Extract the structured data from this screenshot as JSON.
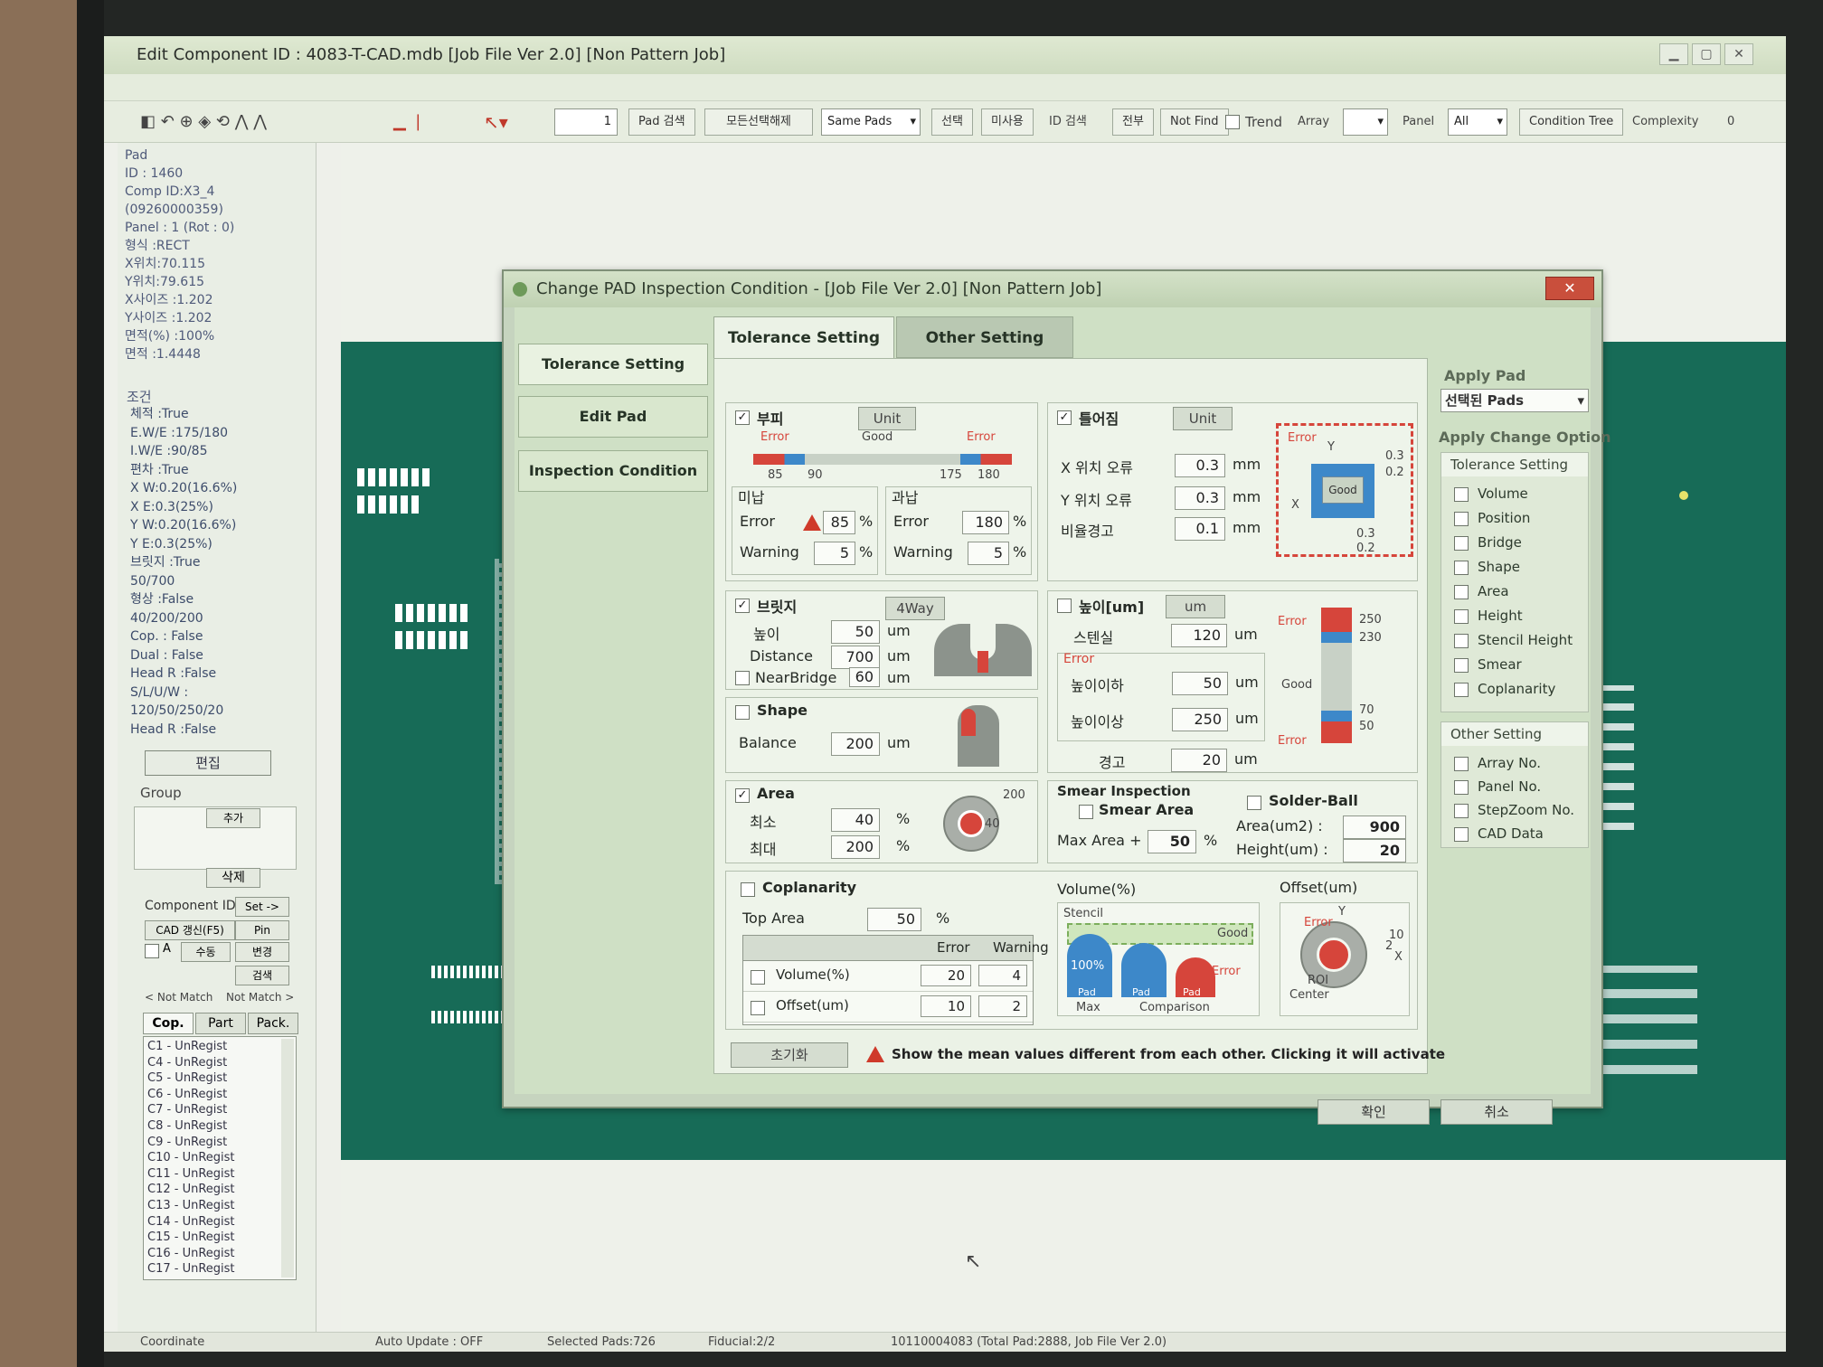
{
  "window": {
    "title": "Edit Component ID : 4083-T-CAD.mdb [Job File Ver 2.0] [Non Pattern Job]"
  },
  "toolbar": {
    "pad_no": "1",
    "pad_search": "Pad 검색",
    "select_all_cancel": "모든선택해제",
    "same_pads": "Same Pads",
    "select": "선택",
    "unselect": "미사용",
    "id_search": "ID 검색",
    "all": "전부",
    "not_find": "Not Find",
    "trend": "Trend",
    "array": "Array",
    "panel": "Panel",
    "panel_value": "All",
    "condition_tree": "Condition Tree",
    "complexity": "Complexity",
    "complexity_value": "0"
  },
  "info": {
    "lines": [
      "Pad",
      "ID  : 1460",
      "Comp ID:X3_4",
      "(09260000359)",
      "Panel : 1 (Rot : 0)",
      "형식 :RECT",
      "X위치:70.115",
      "Y위치:79.615",
      "X사이즈 :1.202",
      "Y사이즈 :1.202",
      "면적(%) :100%",
      "면적  :1.4448"
    ],
    "cond_title": "조건",
    "cond_lines": [
      "체적 :True",
      "E.W/E :175/180",
      "I.W/E :90/85",
      "편차 :True",
      "X W:0.20(16.6%)",
      "X E:0.3(25%)",
      "Y W:0.20(16.6%)",
      "Y E:0.3(25%)",
      "브릿지 :True",
      "50/700",
      "형상 :False",
      "40/200/200",
      "Cop.  : False",
      "Dual  : False",
      "Head R :False",
      "S/L/U/W :",
      "120/50/250/20",
      "Head R :False"
    ],
    "edit": "편집",
    "group": "Group",
    "add": "추가",
    "delete": "삭제",
    "component_id": "Component ID",
    "set": "Set ->",
    "cad_update": "CAD 갱신(F5)",
    "pin": "Pin",
    "a_label": "A",
    "register": "수동",
    "change": "변경",
    "search": "검색",
    "not_match_left": "< Not Match",
    "not_match_right": "Not Match >",
    "tabs": [
      "Cop.",
      "Part",
      "Pack."
    ],
    "list": [
      "C1 - UnRegist",
      "C4 - UnRegist",
      "C5 - UnRegist",
      "C6 - UnRegist",
      "C7 - UnRegist",
      "C8 - UnRegist",
      "C9 - UnRegist",
      "C10 - UnRegist",
      "C11 - UnRegist",
      "C12 - UnRegist",
      "C13 - UnRegist",
      "C14 - UnRegist",
      "C15 - UnRegist",
      "C16 - UnRegist",
      "C17 - UnRegist"
    ]
  },
  "status": {
    "coordinate": "Coordinate",
    "auto_update": "Auto Update : OFF",
    "selected_pads": "Selected Pads:726",
    "fiducial": "Fiducial:2/2",
    "job": "10110004083 (Total Pad:2888, Job File Ver 2.0)"
  },
  "dialog": {
    "title": "Change PAD Inspection Condition - [Job File Ver 2.0] [Non Pattern Job]",
    "close": "✕",
    "nav": [
      "Tolerance Setting",
      "Edit Pad",
      "Inspection Condition"
    ],
    "tabs": [
      "Tolerance Setting",
      "Other Setting"
    ],
    "volume": {
      "title": "부피",
      "unit_btn": "Unit",
      "error_l": "Error",
      "good": "Good",
      "error_r": "Error",
      "ticks": [
        "85",
        "90",
        "175",
        "180"
      ],
      "under": "미납",
      "over": "과납",
      "error": "Error",
      "warning": "Warning",
      "under_error": "85",
      "under_warning": "5",
      "over_error": "180",
      "over_warning": "5",
      "pct": "%"
    },
    "offset": {
      "title": "틀어짐",
      "unit_btn": "Unit",
      "x_err": "X 위치 오류",
      "y_err": "Y 위치 오류",
      "ratio": "비율경고",
      "x_val": "0.3",
      "y_val": "0.3",
      "ratio_val": "0.1",
      "mm": "mm",
      "diag_error": "Error",
      "diag_good": "Good",
      "diag_y": "Y",
      "diag_x": "X",
      "diag_v1": "0.3",
      "diag_v2": "0.2",
      "diag_v3": "0.3",
      "diag_v4": "0.2"
    },
    "bridge": {
      "title": "브릿지",
      "way_btn": "4Way",
      "height": "높이",
      "height_val": "50",
      "distance": "Distance",
      "distance_val": "700",
      "nearbridge": "NearBridge",
      "nearbridge_val": "60",
      "um": "um"
    },
    "height": {
      "title": "높이[um]",
      "um_btn": "um",
      "stencil": "스텐실",
      "stencil_val": "120",
      "error_grp": "Error",
      "low": "높이이하",
      "low_val": "50",
      "high": "높이이상",
      "high_val": "250",
      "warn": "경고",
      "warn_val": "20",
      "um": "um",
      "diag_error_top": "Error",
      "diag_good": "Good",
      "diag_error_bottom": "Error",
      "diag_ticks": [
        "250",
        "230",
        "70",
        "50"
      ]
    },
    "shape": {
      "title": "Shape",
      "balance": "Balance",
      "balance_val": "200",
      "um": "um"
    },
    "area": {
      "title": "Area",
      "min": "최소",
      "max": "최대",
      "min_val": "40",
      "max_val": "200",
      "pct": "%",
      "diag_200": "200",
      "diag_40": "40"
    },
    "smear": {
      "title": "Smear Inspection",
      "area_title": "Smear Area",
      "max_area": "Max Area +",
      "max_area_val": "50",
      "pct": "%",
      "solder_ball": "Solder-Ball",
      "area_um2": "Area(um2) :",
      "area_um2_val": "900",
      "height_um": "Height(um) :",
      "height_um_val": "20"
    },
    "coplanarity": {
      "title": "Coplanarity",
      "top_area": "Top Area",
      "top_area_val": "50",
      "pct": "%",
      "col_error": "Error",
      "col_warning": "Warning",
      "rows": [
        {
          "name": "Volume(%)",
          "error": "20",
          "warning": "4"
        },
        {
          "name": "Offset(um)",
          "error": "10",
          "warning": "2"
        }
      ],
      "vol_title": "Volume(%)",
      "off_title": "Offset(um)",
      "vol_stencil": "Stencil",
      "vol_good": "Good",
      "vol_100": "100%",
      "vol_error": "Error",
      "vol_pad": "Pad",
      "vol_max": "Max",
      "vol_comparison": "Comparison",
      "off_error": "Error",
      "off_y": "Y",
      "off_x": "X",
      "off_10": "10",
      "off_2": "2",
      "off_roi": "ROI",
      "off_center": "Center"
    },
    "reset": "초기화",
    "notice": "Show the mean values different from each other. Clicking it will activate",
    "ok": "확인",
    "cancel": "취소",
    "apply_pad": "Apply Pad",
    "apply_pad_value": "선택된 Pads",
    "apply_change_option": "Apply Change Option",
    "tolerance_setting": "Tolerance Setting",
    "tol_items": [
      "Volume",
      "Position",
      "Bridge",
      "Shape",
      "Area",
      "Height",
      "Stencil Height",
      "Smear",
      "Coplanarity"
    ],
    "other_setting": "Other Setting",
    "other_items": [
      "Array No.",
      "Panel No.",
      "StepZoom No.",
      "CAD Data"
    ]
  },
  "colors": {
    "canvas": "#176b57",
    "error_red": "#d6453b",
    "good_blue": "#3d88c9",
    "dialog_bg": "#c6d4bf"
  }
}
